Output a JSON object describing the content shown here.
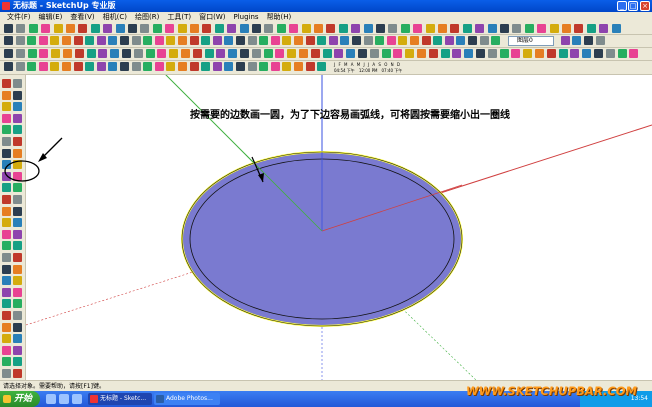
{
  "window": {
    "title": "无标题 - SketchUp 专业版"
  },
  "menu": [
    "文件(F)",
    "编辑(E)",
    "查看(V)",
    "相机(C)",
    "绘图(R)",
    "工具(T)",
    "窗口(W)",
    "Plugins",
    "帮助(H)"
  ],
  "toolbar": {
    "layer_select": "图层0"
  },
  "shadow_bar": {
    "letters": "J F M A M J J A S O N D",
    "time_start": "04:54 下午",
    "time_mid": "12:00 PM",
    "time_end": "07:40 下午"
  },
  "annotation": "按需要的边数画一圆，为了下边容易画弧线，可将圆按需要缩小出一圈线",
  "status": "请选择对象。需要帮助，请按[F1]键。",
  "taskbar": {
    "start": "开始",
    "tasks": [
      {
        "label": "无标题 - Sketc...",
        "state": "active"
      },
      {
        "label": "Adobe Photos...",
        "state": "inactive"
      }
    ],
    "clock": "13:54"
  },
  "watermark": "WWW.SKETCHUPBAR.COM",
  "colors": {
    "face": "#7a7ad0",
    "edge_highlight": "#ffff44",
    "axis_red": "#d04040",
    "axis_green": "#40b040",
    "axis_blue": "#3a50e0"
  }
}
